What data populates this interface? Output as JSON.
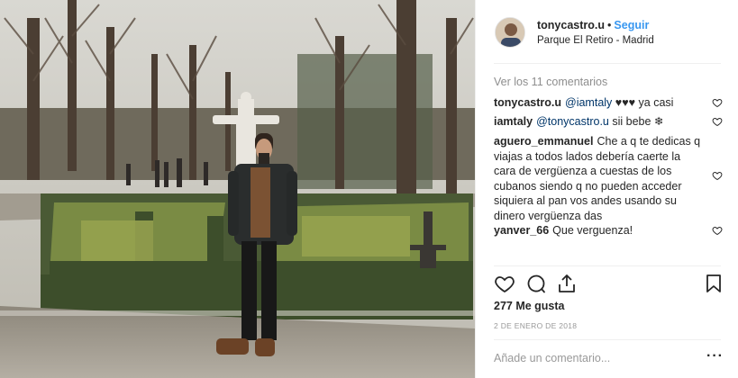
{
  "post": {
    "username": "tonycastro.u",
    "separator": "•",
    "follow_label": "Seguir",
    "location": "Parque El Retiro - Madrid",
    "view_all_comments": "Ver los 11 comentarios",
    "likes": "277 Me gusta",
    "date": "2 DE ENERO DE 2018",
    "add_comment_placeholder": "Añade un comentario...",
    "more_icon": "more-options-icon"
  },
  "comments": [
    {
      "user": "tonycastro.u",
      "mention": "@iamtaly",
      "text": " ♥♥♥ ya casi"
    },
    {
      "user": "iamtaly",
      "mention": "@tonycastro.u",
      "text": " sii bebe ❄"
    },
    {
      "user": "aguero_emmanuel",
      "mention": "",
      "text": "Che a q te dedicas q viajas a todos lados debería caerte la cara de vergüenza a cuestas de los cubanos siendo q no pueden acceder siquiera al pan vos andes usando su dinero vergüenza das"
    },
    {
      "user": "yanver_66",
      "mention": "",
      "text": "Que verguenza!"
    }
  ],
  "icons": [
    "heart-icon",
    "comment-icon",
    "share-icon",
    "bookmark-icon"
  ],
  "colors": {
    "link": "#3897f0",
    "mention": "#003569",
    "muted": "#8e8e8e",
    "text": "#262626"
  }
}
